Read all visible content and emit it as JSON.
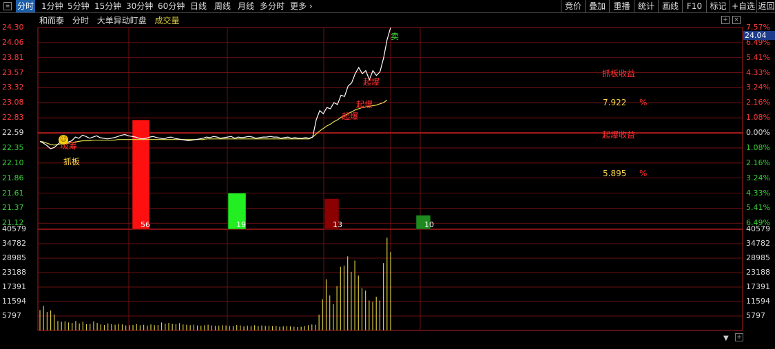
{
  "toolbar": {
    "tabs": [
      "分时",
      "1分钟",
      "5分钟",
      "15分钟",
      "30分钟",
      "60分钟",
      "日线",
      "周线",
      "月线",
      "多分时",
      "更多"
    ],
    "active": "分时",
    "right_buttons": [
      "竞价",
      "叠加",
      "重播",
      "统计",
      "画线",
      "F10",
      "标记",
      "+自选",
      "返回"
    ]
  },
  "subtitle": {
    "stock_name": "和而泰",
    "mode": "分时",
    "indicator": "大单异动盯盘",
    "volume_label": "成交量"
  },
  "price_axis": {
    "labels": [
      "24.30",
      "24.06",
      "23.81",
      "23.57",
      "23.32",
      "23.08",
      "22.83",
      "22.59",
      "22.35",
      "22.10",
      "21.86",
      "21.61",
      "21.37",
      "21.12"
    ],
    "colors": [
      "red",
      "red",
      "red",
      "red",
      "red",
      "red",
      "red",
      "white",
      "green",
      "green",
      "green",
      "green",
      "green",
      "green"
    ]
  },
  "pct_axis": {
    "labels": [
      "7.57%",
      "6.49%",
      "5.41%",
      "4.33%",
      "3.24%",
      "2.16%",
      "1.08%",
      "0.00%",
      "1.08%",
      "2.16%",
      "3.24%",
      "4.33%",
      "5.41%",
      "6.49%"
    ],
    "colors": [
      "red",
      "red",
      "red",
      "red",
      "red",
      "red",
      "red",
      "white",
      "green",
      "green",
      "green",
      "green",
      "green",
      "green"
    ]
  },
  "volume_axis": {
    "labels": [
      "40579",
      "34782",
      "28985",
      "23188",
      "17391",
      "11594",
      "5797"
    ]
  },
  "current_price": "24.04",
  "annotations": {
    "sell": "卖",
    "explode1": "起爆",
    "explode2": "起爆",
    "explode3": "起爆",
    "catch_board": "抓板",
    "gather": "吸筹",
    "board_income_label": "抓板收益",
    "board_income_value": "7.922",
    "board_income_unit": "%",
    "explode_income_label": "起爆收益",
    "explode_income_value": "5.895",
    "explode_income_unit": "%"
  },
  "chart_data": {
    "type": "line",
    "price_range": [
      21.12,
      24.3
    ],
    "pre_close": 22.59,
    "price_series": [
      22.45,
      22.42,
      22.38,
      22.33,
      22.35,
      22.4,
      22.45,
      22.42,
      22.44,
      22.46,
      22.52,
      22.5,
      22.55,
      22.53,
      22.5,
      22.52,
      22.54,
      22.51,
      22.5,
      22.49,
      22.5,
      22.51,
      22.53,
      22.55,
      22.56,
      22.54,
      22.53,
      22.52,
      22.5,
      22.49,
      22.5,
      22.52,
      22.53,
      22.51,
      22.5,
      22.49,
      22.51,
      22.52,
      22.5,
      22.49,
      22.48,
      22.47,
      22.46,
      22.47,
      22.48,
      22.49,
      22.5,
      22.52,
      22.51,
      22.53,
      22.52,
      22.5,
      22.51,
      22.52,
      22.53,
      22.5,
      22.52,
      22.51,
      22.52,
      22.53,
      22.52,
      22.5,
      22.51,
      22.52,
      22.52,
      22.53,
      22.52,
      22.52,
      22.5,
      22.51,
      22.52,
      22.5,
      22.51,
      22.5,
      22.5,
      22.51,
      22.5,
      22.52,
      22.8,
      22.95,
      22.9,
      23.0,
      22.98,
      23.08,
      23.05,
      23.2,
      23.18,
      23.35,
      23.4,
      23.55,
      23.65,
      23.55,
      23.6,
      23.45,
      23.6,
      23.52,
      23.58,
      23.8,
      24.1,
      24.3
    ],
    "avg_series": [
      22.45,
      22.44,
      22.42,
      22.4,
      22.39,
      22.4,
      22.41,
      22.41,
      22.42,
      22.43,
      22.44,
      22.45,
      22.46,
      22.46,
      22.46,
      22.47,
      22.47,
      22.47,
      22.47,
      22.47,
      22.47,
      22.47,
      22.48,
      22.48,
      22.48,
      22.48,
      22.48,
      22.48,
      22.48,
      22.48,
      22.48,
      22.48,
      22.48,
      22.48,
      22.48,
      22.48,
      22.48,
      22.48,
      22.48,
      22.48,
      22.48,
      22.48,
      22.48,
      22.48,
      22.48,
      22.48,
      22.48,
      22.49,
      22.49,
      22.49,
      22.49,
      22.49,
      22.49,
      22.49,
      22.49,
      22.49,
      22.49,
      22.49,
      22.49,
      22.49,
      22.49,
      22.49,
      22.49,
      22.49,
      22.49,
      22.49,
      22.49,
      22.49,
      22.49,
      22.49,
      22.49,
      22.49,
      22.49,
      22.49,
      22.49,
      22.49,
      22.49,
      22.52,
      22.57,
      22.62,
      22.66,
      22.7,
      22.73,
      22.77,
      22.8,
      22.84,
      22.87,
      22.9,
      22.93,
      22.96,
      22.98,
      23.0,
      23.01,
      23.02,
      23.03,
      23.04,
      23.06,
      23.08,
      23.12
    ],
    "big_order_bars": [
      {
        "label": "56",
        "color": "#ff1010",
        "value_price": 22.8
      },
      {
        "label": "19",
        "color": "#22ee22",
        "value_price": 21.61
      },
      {
        "label": "13",
        "color": "#8b0000",
        "value_price": 21.52
      },
      {
        "label": "10",
        "color": "#1f8a1f",
        "value_price": 21.25
      }
    ],
    "volume_range": [
      0,
      40579
    ],
    "volume": [
      8200,
      9800,
      7400,
      8000,
      6400,
      3800,
      3500,
      3600,
      3200,
      3000,
      3800,
      2800,
      3500,
      2500,
      2600,
      3600,
      3000,
      2400,
      2200,
      2800,
      2500,
      2300,
      2600,
      2400,
      2000,
      2100,
      2200,
      2500,
      2100,
      2300,
      2000,
      2400,
      2100,
      2200,
      3200,
      2700,
      3000,
      2600,
      2500,
      2900,
      2400,
      2300,
      2100,
      2300,
      2000,
      1900,
      2100,
      2300,
      2000,
      1800,
      1900,
      2100,
      2000,
      1800,
      1700,
      2200,
      2000,
      1600,
      1900,
      1800,
      2100,
      1700,
      2000,
      1800,
      1900,
      1700,
      1800,
      1500,
      1600,
      1700,
      1600,
      1500,
      1400,
      1500,
      1700,
      2100,
      2400,
      2300,
      6300,
      12500,
      20500,
      14000,
      10500,
      17800,
      25500,
      26000,
      29700,
      23500,
      28000,
      22000,
      17000,
      16000,
      12000,
      11500,
      13500,
      12000,
      27000,
      37200,
      31500
    ]
  }
}
